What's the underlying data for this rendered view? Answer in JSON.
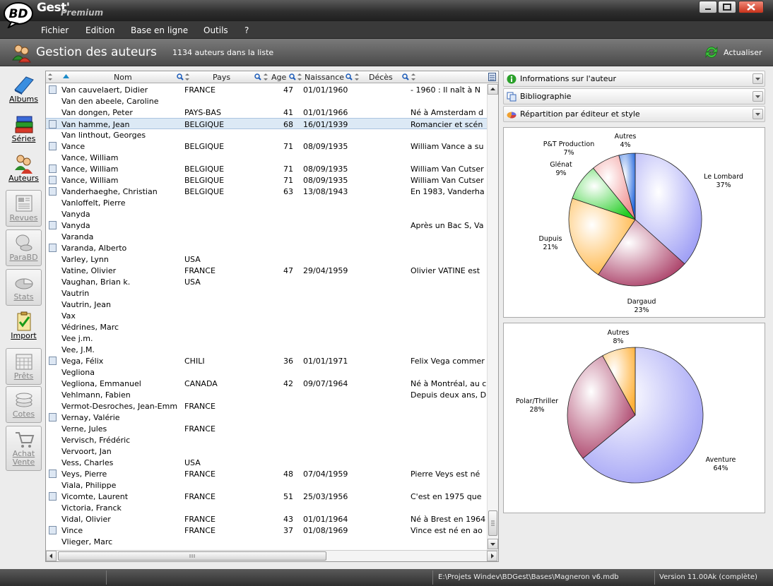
{
  "app": {
    "title": "Gest'",
    "logo_text": "BD",
    "edition": "Premium"
  },
  "menu": [
    "Fichier",
    "Edition",
    "Base en ligne",
    "Outils",
    "?"
  ],
  "header": {
    "title": "Gestion des auteurs",
    "count": "1134 auteurs dans la liste",
    "refresh_label": "Actualiser"
  },
  "sidebar": [
    {
      "label": "Albums",
      "icon": "book-icon",
      "enabled": true
    },
    {
      "label": "Séries",
      "icon": "books-stack-icon",
      "enabled": true
    },
    {
      "label": "Auteurs",
      "icon": "authors-icon",
      "enabled": true
    },
    {
      "label": "Revues",
      "icon": "newspaper-icon",
      "enabled": false
    },
    {
      "label": "ParaBD",
      "icon": "parabd-icon",
      "enabled": false
    },
    {
      "label": "Stats",
      "icon": "stats-icon",
      "enabled": false
    },
    {
      "label": "Import",
      "icon": "clipboard-check-icon",
      "enabled": true
    },
    {
      "label": "Prêts",
      "icon": "calendar-icon",
      "enabled": false
    },
    {
      "label": "Cotes",
      "icon": "coins-icon",
      "enabled": false
    },
    {
      "label": "Achat Vente",
      "icon": "cart-icon",
      "enabled": false
    }
  ],
  "columns": {
    "nom": "Nom",
    "pays": "Pays",
    "age": "Age",
    "naissance": "Naissance",
    "deces": "Décès"
  },
  "rows": [
    {
      "pic": true,
      "name": "Van cauvelaert, Didier",
      "pays": "FRANCE",
      "age": "47",
      "naissance": "01/01/1960",
      "bio": "- 1960 : Il naît à N"
    },
    {
      "pic": false,
      "name": "Van den abeele, Caroline",
      "pays": "",
      "age": "",
      "naissance": "",
      "bio": ""
    },
    {
      "pic": false,
      "name": "Van dongen, Peter",
      "pays": "PAYS-BAS",
      "age": "41",
      "naissance": "01/01/1966",
      "bio": "Né à Amsterdam d"
    },
    {
      "pic": true,
      "name": "Van hamme, Jean",
      "pays": "BELGIQUE",
      "age": "68",
      "naissance": "16/01/1939",
      "bio": "Romancier et scén",
      "selected": true
    },
    {
      "pic": false,
      "name": "Van linthout, Georges",
      "pays": "",
      "age": "",
      "naissance": "",
      "bio": ""
    },
    {
      "pic": true,
      "name": "Vance",
      "pays": "BELGIQUE",
      "age": "71",
      "naissance": "08/09/1935",
      "bio": "William Vance a su"
    },
    {
      "pic": false,
      "name": "Vance, William",
      "pays": "",
      "age": "",
      "naissance": "",
      "bio": ""
    },
    {
      "pic": true,
      "name": "Vance, William",
      "pays": "BELGIQUE",
      "age": "71",
      "naissance": "08/09/1935",
      "bio": "William Van Cutser"
    },
    {
      "pic": true,
      "name": "Vance, William",
      "pays": "BELGIQUE",
      "age": "71",
      "naissance": "08/09/1935",
      "bio": "William Van Cutser"
    },
    {
      "pic": true,
      "name": "Vanderhaeghe, Christian",
      "pays": "BELGIQUE",
      "age": "63",
      "naissance": "13/08/1943",
      "bio": "En 1983, Vanderha"
    },
    {
      "pic": false,
      "name": "Vanloffelt, Pierre",
      "pays": "",
      "age": "",
      "naissance": "",
      "bio": ""
    },
    {
      "pic": false,
      "name": "Vanyda",
      "pays": "",
      "age": "",
      "naissance": "",
      "bio": ""
    },
    {
      "pic": true,
      "name": "Vanyda",
      "pays": "",
      "age": "",
      "naissance": "",
      "bio": "Après un Bac S, Va"
    },
    {
      "pic": false,
      "name": "Varanda",
      "pays": "",
      "age": "",
      "naissance": "",
      "bio": ""
    },
    {
      "pic": true,
      "name": "Varanda, Alberto",
      "pays": "",
      "age": "",
      "naissance": "",
      "bio": ""
    },
    {
      "pic": false,
      "name": "Varley, Lynn",
      "pays": "USA",
      "age": "",
      "naissance": "",
      "bio": ""
    },
    {
      "pic": false,
      "name": "Vatine, Olivier",
      "pays": "FRANCE",
      "age": "47",
      "naissance": "29/04/1959",
      "bio": "Olivier VATINE est"
    },
    {
      "pic": false,
      "name": "Vaughan, Brian k.",
      "pays": "USA",
      "age": "",
      "naissance": "",
      "bio": ""
    },
    {
      "pic": false,
      "name": "Vautrin",
      "pays": "",
      "age": "",
      "naissance": "",
      "bio": ""
    },
    {
      "pic": false,
      "name": "Vautrin, Jean",
      "pays": "",
      "age": "",
      "naissance": "",
      "bio": ""
    },
    {
      "pic": false,
      "name": "Vax",
      "pays": "",
      "age": "",
      "naissance": "",
      "bio": ""
    },
    {
      "pic": false,
      "name": "Védrines, Marc",
      "pays": "",
      "age": "",
      "naissance": "",
      "bio": ""
    },
    {
      "pic": false,
      "name": "Vee j.m.",
      "pays": "",
      "age": "",
      "naissance": "",
      "bio": ""
    },
    {
      "pic": false,
      "name": "Vee, J.M.",
      "pays": "",
      "age": "",
      "naissance": "",
      "bio": ""
    },
    {
      "pic": true,
      "name": "Vega, Félix",
      "pays": "CHILI",
      "age": "36",
      "naissance": "01/01/1971",
      "bio": "Felix Vega commer"
    },
    {
      "pic": false,
      "name": "Vegliona",
      "pays": "",
      "age": "",
      "naissance": "",
      "bio": ""
    },
    {
      "pic": false,
      "name": "Vegliona, Emmanuel",
      "pays": "CANADA",
      "age": "42",
      "naissance": "09/07/1964",
      "bio": "Né à Montréal, au c"
    },
    {
      "pic": false,
      "name": "Vehlmann, Fabien",
      "pays": "",
      "age": "",
      "naissance": "",
      "bio": "Depuis deux ans, D"
    },
    {
      "pic": false,
      "name": "Vermot-Desroches, Jean-Emm",
      "pays": "FRANCE",
      "age": "",
      "naissance": "",
      "bio": ""
    },
    {
      "pic": true,
      "name": "Vernay, Valérie",
      "pays": "",
      "age": "",
      "naissance": "",
      "bio": ""
    },
    {
      "pic": false,
      "name": "Verne, Jules",
      "pays": "FRANCE",
      "age": "",
      "naissance": "",
      "bio": ""
    },
    {
      "pic": false,
      "name": "Vervisch, Frédéric",
      "pays": "",
      "age": "",
      "naissance": "",
      "bio": ""
    },
    {
      "pic": false,
      "name": "Vervoort, Jan",
      "pays": "",
      "age": "",
      "naissance": "",
      "bio": ""
    },
    {
      "pic": false,
      "name": "Vess, Charles",
      "pays": "USA",
      "age": "",
      "naissance": "",
      "bio": ""
    },
    {
      "pic": true,
      "name": "Veys, Pierre",
      "pays": "FRANCE",
      "age": "48",
      "naissance": "07/04/1959",
      "bio": "Pierre Veys est né"
    },
    {
      "pic": false,
      "name": "Viala, Philippe",
      "pays": "",
      "age": "",
      "naissance": "",
      "bio": ""
    },
    {
      "pic": true,
      "name": "Vicomte, Laurent",
      "pays": "FRANCE",
      "age": "51",
      "naissance": "25/03/1956",
      "bio": "C'est en 1975 que"
    },
    {
      "pic": false,
      "name": "Victoria, Franck",
      "pays": "",
      "age": "",
      "naissance": "",
      "bio": ""
    },
    {
      "pic": false,
      "name": "Vidal, Olivier",
      "pays": "FRANCE",
      "age": "43",
      "naissance": "01/01/1964",
      "bio": "Né à Brest en 1964"
    },
    {
      "pic": true,
      "name": "Vince",
      "pays": "FRANCE",
      "age": "37",
      "naissance": "01/08/1969",
      "bio": "Vince est né en ao"
    },
    {
      "pic": false,
      "name": "Vlieger, Marc",
      "pays": "",
      "age": "",
      "naissance": "",
      "bio": ""
    }
  ],
  "panels": {
    "info": "Informations sur l'auteur",
    "biblio": "Bibliographie",
    "repartition": "Répartition par éditeur et style"
  },
  "chart_data": [
    {
      "type": "pie",
      "title": "",
      "labels": [
        "Le Lombard",
        "Dargaud",
        "Dupuis",
        "Glénat",
        "P&T Production",
        "Autres"
      ],
      "values": [
        37,
        23,
        21,
        9,
        7,
        4
      ],
      "value_labels": [
        "37%",
        "23%",
        "21%",
        "9%",
        "7%",
        "4%"
      ],
      "colors": [
        "#9f9ff5",
        "#a83a63",
        "#ffb13a",
        "#22cc22",
        "#f08b8b",
        "#2266dd"
      ]
    },
    {
      "type": "pie",
      "title": "",
      "labels": [
        "Aventure",
        "Polar/Thriller",
        "Autres"
      ],
      "values": [
        64,
        28,
        8
      ],
      "value_labels": [
        "64%",
        "28%",
        "8%"
      ],
      "colors": [
        "#9f9ff5",
        "#a83a63",
        "#ffb13a"
      ]
    }
  ],
  "status": {
    "path": "E:\\Projets Windev\\BDGest\\Bases\\Magneron v6.mdb",
    "version": "Version 11.00Ak (complète)"
  }
}
